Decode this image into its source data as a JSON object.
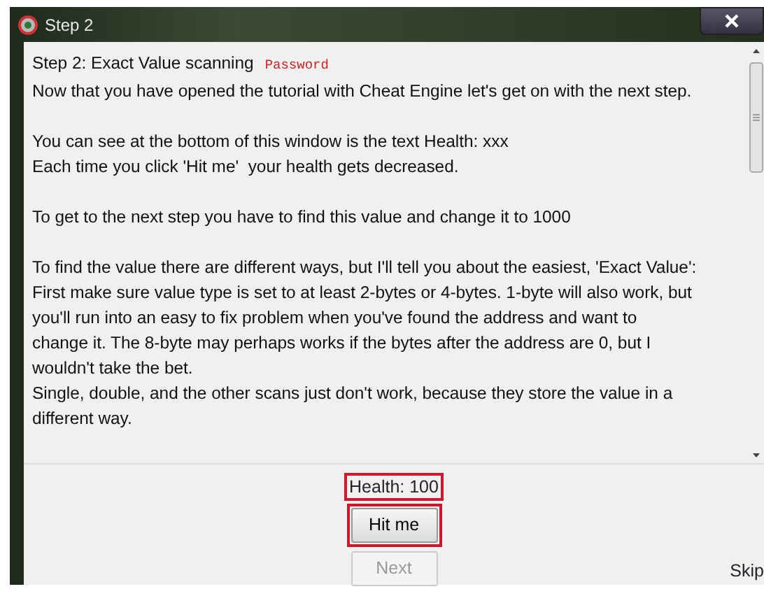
{
  "window": {
    "title": "Step 2"
  },
  "tutorial": {
    "heading": "Step 2: Exact Value scanning",
    "password_label": "Password",
    "paragraphs": [
      "Now that you have opened the tutorial with Cheat Engine let's get on with the next step.",
      "You can see at the bottom of this window is the text Health: xxx\nEach time you click 'Hit me'  your health gets decreased.",
      "To get to the next step you have to find this value and change it to 1000",
      "To find the value there are different ways, but I'll tell you about the easiest, 'Exact Value':\nFirst make sure value type is set to at least 2-bytes or 4-bytes. 1-byte will also work, but\nyou'll run into an easy to fix problem when you've found the address and want to\nchange it. The 8-byte may perhaps works if the bytes after the address are 0, but I\nwouldn't take the bet.\nSingle, double, and the other scans just don't work, because they store the value in a\ndifferent way."
    ]
  },
  "health": {
    "text": "Health: 100",
    "highlighted": true
  },
  "buttons": [
    {
      "label": "Hit me",
      "highlighted": true,
      "disabled": false
    },
    {
      "label": "Next",
      "highlighted": false,
      "disabled": true
    }
  ],
  "skip": {
    "label": "Skip"
  }
}
